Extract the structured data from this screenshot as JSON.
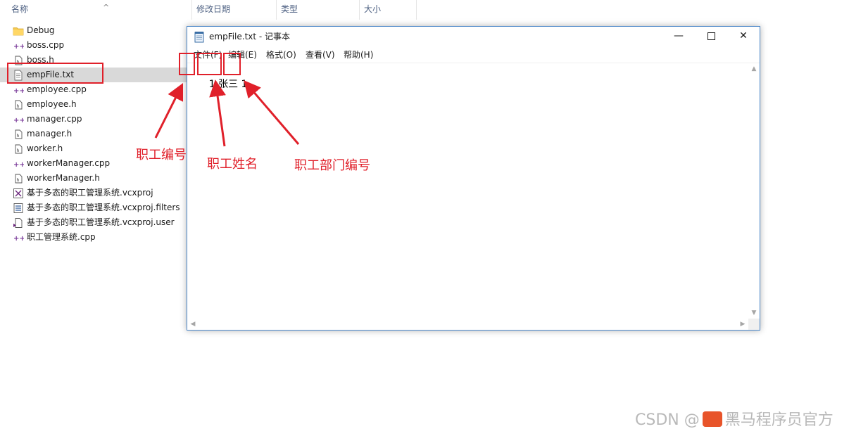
{
  "explorer": {
    "columns": {
      "name": "名称",
      "date_modified": "修改日期",
      "type": "类型",
      "size": "大小"
    },
    "files": [
      {
        "name": "Debug",
        "icon": "folder-icon"
      },
      {
        "name": "boss.cpp",
        "icon": "cpp-file-icon"
      },
      {
        "name": "boss.h",
        "icon": "header-file-icon"
      },
      {
        "name": "empFile.txt",
        "icon": "text-file-icon",
        "selected": true
      },
      {
        "name": "employee.cpp",
        "icon": "cpp-file-icon"
      },
      {
        "name": "employee.h",
        "icon": "header-file-icon"
      },
      {
        "name": "manager.cpp",
        "icon": "cpp-file-icon"
      },
      {
        "name": "manager.h",
        "icon": "header-file-icon"
      },
      {
        "name": "worker.h",
        "icon": "header-file-icon"
      },
      {
        "name": "workerManager.cpp",
        "icon": "cpp-file-icon"
      },
      {
        "name": "workerManager.h",
        "icon": "header-file-icon"
      },
      {
        "name": "基于多态的职工管理系统.vcxproj",
        "icon": "vcxproj-file-icon"
      },
      {
        "name": "基于多态的职工管理系统.vcxproj.filters",
        "icon": "filters-file-icon"
      },
      {
        "name": "基于多态的职工管理系统.vcxproj.user",
        "icon": "user-file-icon"
      },
      {
        "name": "职工管理系统.cpp",
        "icon": "cpp-file-icon"
      }
    ]
  },
  "notepad": {
    "title": "empFile.txt - 记事本",
    "menu": [
      "文件(F)",
      "编辑(E)",
      "格式(O)",
      "查看(V)",
      "帮助(H)"
    ],
    "content": {
      "id": "1",
      "name": "张三",
      "dept": "1"
    }
  },
  "annotations": {
    "id_label": "职工编号",
    "name_label": "职工姓名",
    "dept_label": "职工部门编号",
    "color": "#e0202a"
  },
  "watermark": {
    "prefix": "CSDN @",
    "suffix": "黑马程序员官方"
  }
}
